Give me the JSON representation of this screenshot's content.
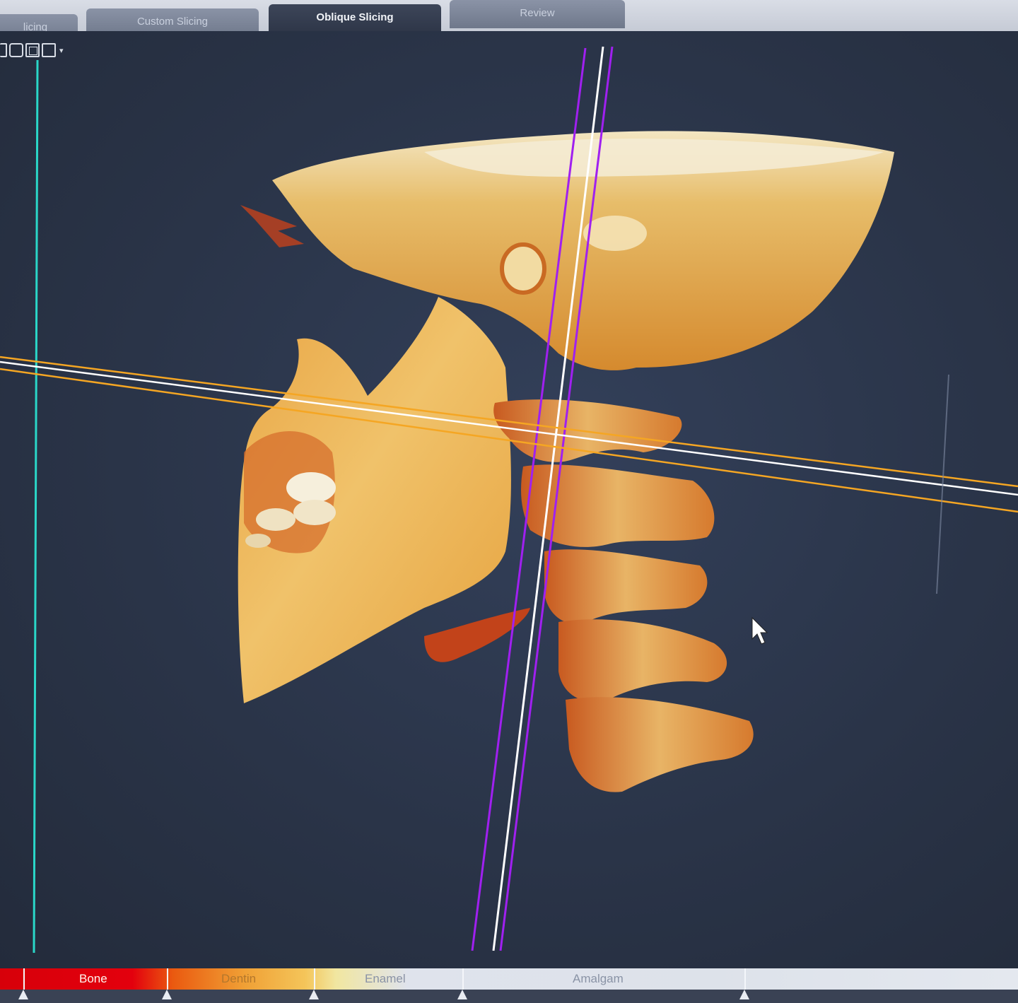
{
  "tabs": {
    "slicing": "licing",
    "custom_slicing": "Custom Slicing",
    "oblique_slicing": "Oblique Slicing",
    "review": "Review"
  },
  "active_tab": "Oblique Slicing",
  "toolbar": {
    "icons": [
      "view-box-icon",
      "view-rounded-box-icon",
      "view-layered-box-icon",
      "view-square-icon",
      "dropdown-arrow-icon"
    ],
    "dropdown_glyph": "▾"
  },
  "viewport": {
    "content": "3D volume rendering of skull, mandible and cervical spine (lateral view)",
    "guide_colors": {
      "vertical_cyan": "#2ad7c8",
      "oblique_purple": "#a020f0",
      "horizontal_orange": "#f5a623",
      "white": "#ffffff"
    }
  },
  "tissue_bar": {
    "labels": {
      "bone": "Bone",
      "dentin": "Dentin",
      "enamel": "Enamel",
      "amalgam": "Amalgam"
    },
    "colors": {
      "bone": "#e3000d",
      "dentin": "#f0a035",
      "enamel": "#dfe3ec",
      "amalgam": "#e4e8ef"
    }
  }
}
